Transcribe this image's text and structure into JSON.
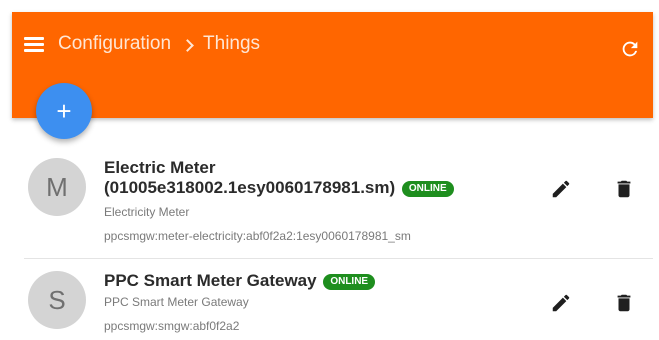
{
  "header": {
    "breadcrumb": [
      "Configuration",
      "Things"
    ],
    "menu_icon": "menu-icon",
    "refresh_icon": "refresh-icon",
    "background_color": "#ff6600"
  },
  "fab": {
    "label": "+",
    "color": "#3d8ff0"
  },
  "things": [
    {
      "avatar": "M",
      "title": "Electric Meter (01005e318002.1esy0060178981.sm)",
      "status": "ONLINE",
      "type": "Electricity Meter",
      "uid": "ppcsmgw:meter-electricity:abf0f2a2:1esy0060178981_sm"
    },
    {
      "avatar": "S",
      "title": "PPC Smart Meter Gateway",
      "status": "ONLINE",
      "type": "PPC Smart Meter Gateway",
      "uid": "ppcsmgw:smgw:abf0f2a2"
    }
  ],
  "colors": {
    "status_online": "#1e8e1e"
  }
}
